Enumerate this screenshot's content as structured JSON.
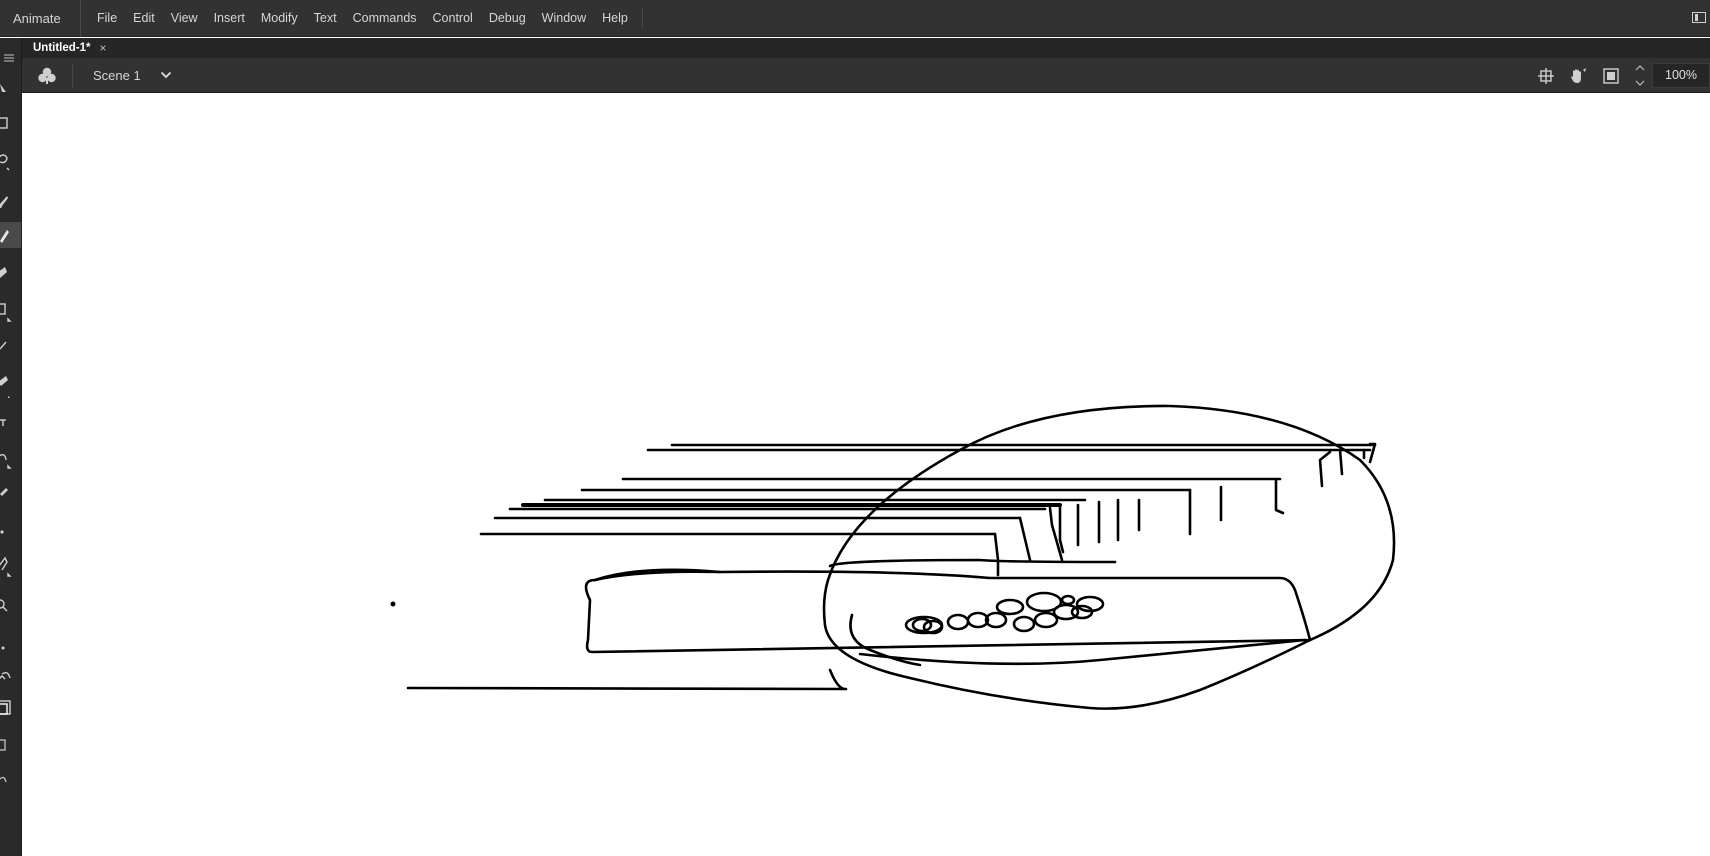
{
  "app": {
    "name": "Animate"
  },
  "menu": {
    "items": [
      {
        "label": "File"
      },
      {
        "label": "Edit"
      },
      {
        "label": "View"
      },
      {
        "label": "Insert"
      },
      {
        "label": "Modify"
      },
      {
        "label": "Text"
      },
      {
        "label": "Commands"
      },
      {
        "label": "Control"
      },
      {
        "label": "Debug"
      },
      {
        "label": "Window"
      },
      {
        "label": "Help"
      }
    ]
  },
  "document": {
    "tab_title": "Untitled-1*",
    "close_glyph": "×"
  },
  "editbar": {
    "scene_name": "Scene 1",
    "zoom": "100%",
    "icons": [
      "edit-symbols-icon",
      "scene-dropdown-icon",
      "snap-icon",
      "hand-tool-icon",
      "clip-canvas-icon",
      "zoom-stepper-icon"
    ]
  },
  "toolbar": {
    "tools": [
      "panel-menu-icon",
      "selection-tool-icon",
      "free-transform-tool-icon",
      "lasso-tool-icon",
      "brush-tool-icon",
      "pencil-tool-icon",
      "paint-bucket-tool-icon",
      "rectangle-tool-icon",
      "line-tool-icon",
      "pen-tool-icon",
      "text-tool-icon",
      "bone-tool-icon",
      "eyedropper-tool-icon",
      "eraser-tool-icon",
      "width-tool-icon",
      "hand-tool-icon",
      "zoom-tool-icon",
      "stroke-color-icon",
      "swap-colors-icon",
      "fill-color-icon",
      "object-drawing-icon",
      "snap-to-objects-icon"
    ],
    "active_tool": "pencil-tool-icon"
  },
  "colors": {
    "menubar_bg": "#323232",
    "toolbar_bg": "#2a2a2a",
    "stage_bg": "#ffffff",
    "stroke": "#000000"
  }
}
